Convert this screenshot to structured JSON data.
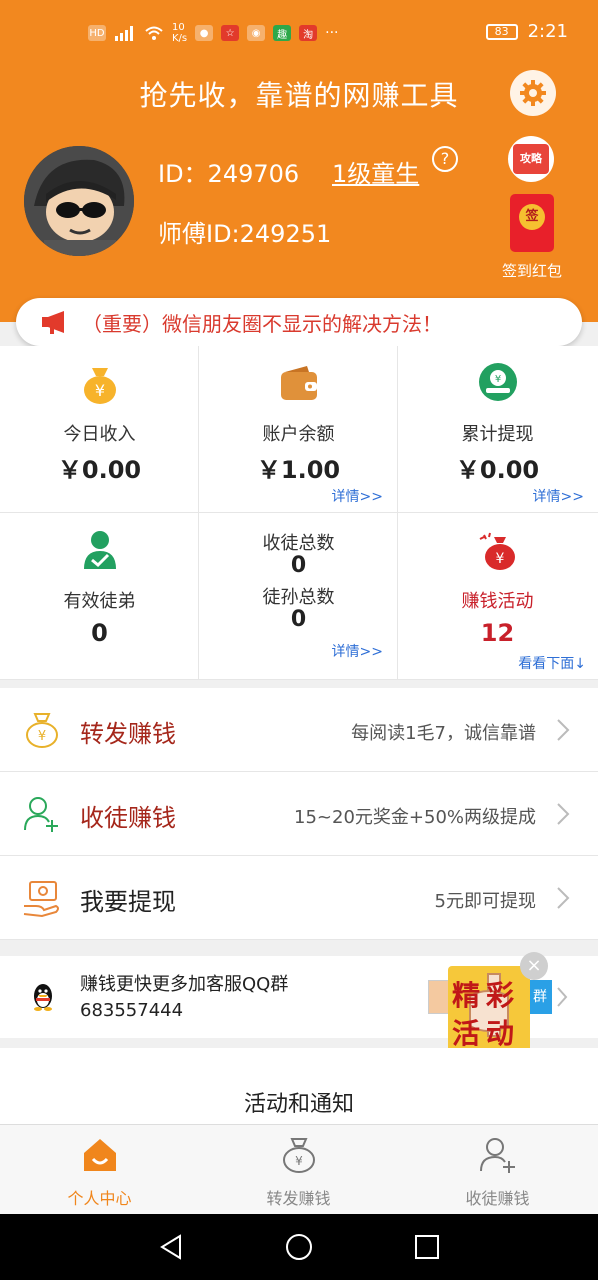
{
  "status_bar": {
    "network": "10\nK/s",
    "battery": "83",
    "time": "2:21"
  },
  "header": {
    "title": "抢先收，靠谱的网赚工具",
    "user_id": "ID：249706",
    "level": "1级童生",
    "help": "?",
    "master_id": "师傅ID:249251",
    "guide_label": "攻略",
    "sign_seal": "签",
    "sign_label": "签到红包"
  },
  "notice": {
    "text": "（重要）微信朋友圈不显示的解决方法！"
  },
  "stats": {
    "today_income_label": "今日收入",
    "today_income_value": "￥0.00",
    "balance_label": "账户余额",
    "balance_value": "￥1.00",
    "balance_more": "详情>>",
    "withdrawn_label": "累计提现",
    "withdrawn_value": "￥0.00",
    "withdrawn_more": "详情>>",
    "valid_apprentice_label": "有效徒弟",
    "valid_apprentice_value": "0",
    "apprentice_total_label": "收徒总数",
    "apprentice_total_value": "0",
    "grand_apprentice_label": "徒孙总数",
    "grand_apprentice_value": "0",
    "apprentice_more": "详情>>",
    "activity_label": "赚钱活动",
    "activity_value": "12",
    "activity_more": "看看下面↓"
  },
  "list": [
    {
      "title": "转发赚钱",
      "desc": "每阅读1毛7，诚信靠谱"
    },
    {
      "title": "收徒赚钱",
      "desc": "15~20元奖金+50%两级提成"
    },
    {
      "title": "我要提现",
      "desc": "5元即可提现"
    }
  ],
  "qq_group": {
    "line1": "赚钱更快更多加客服QQ群",
    "line2": "683557444",
    "join": "群"
  },
  "promo": {
    "line1": "精彩",
    "line2": "活动",
    "close": "×"
  },
  "news_title": "活动和通知",
  "tabs": [
    {
      "label": "个人中心"
    },
    {
      "label": "转发赚钱"
    },
    {
      "label": "收徒赚钱"
    }
  ],
  "colors": {
    "brand_orange": "#f2881f",
    "accent_red": "#c8202a",
    "link_blue": "#2f6fd6"
  }
}
